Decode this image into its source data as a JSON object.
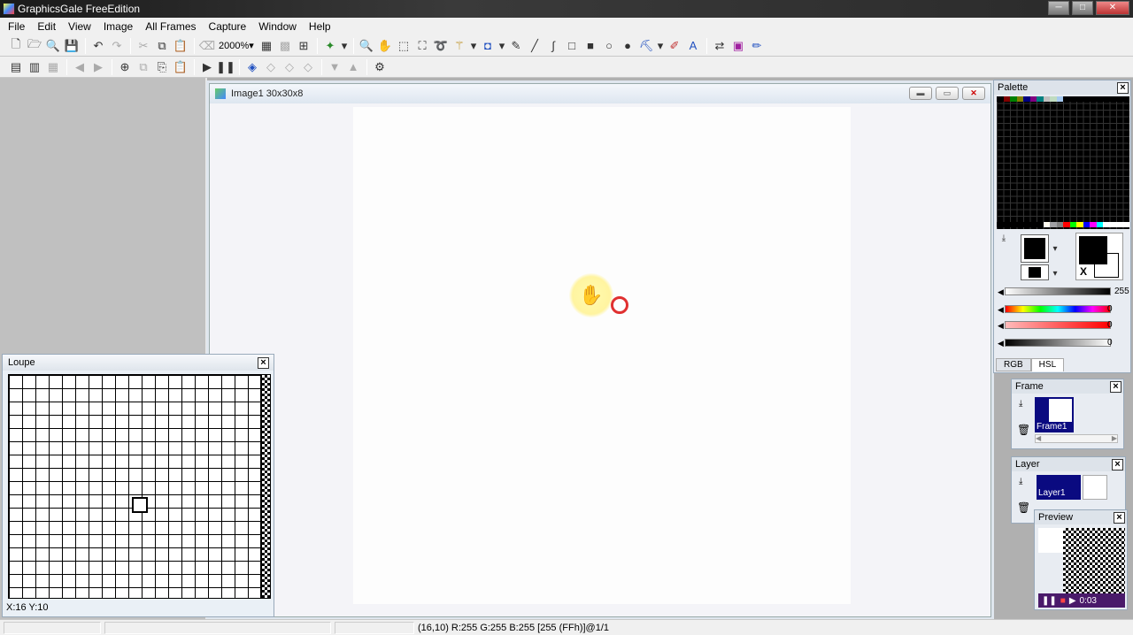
{
  "app": {
    "title": "GraphicsGale FreeEdition"
  },
  "menu": [
    "File",
    "Edit",
    "View",
    "Image",
    "All Frames",
    "Capture",
    "Window",
    "Help"
  ],
  "toolbar": {
    "zoom": "2000%"
  },
  "image_window": {
    "title": "Image1 30x30x8"
  },
  "loupe": {
    "title": "Loupe",
    "status": "X:16 Y:10"
  },
  "palette": {
    "title": "Palette",
    "sliders": [
      "255",
      "0",
      "0",
      "0"
    ],
    "tabs": [
      "RGB",
      "HSL"
    ],
    "x_label": "X"
  },
  "frame": {
    "title": "Frame",
    "item": "Frame1"
  },
  "layer": {
    "title": "Layer",
    "item": "Layer1"
  },
  "preview": {
    "title": "Preview",
    "time": "0:03"
  },
  "status": {
    "text": "(16,10) R:255 G:255 B:255  [255 (FFh)]@1/1"
  }
}
